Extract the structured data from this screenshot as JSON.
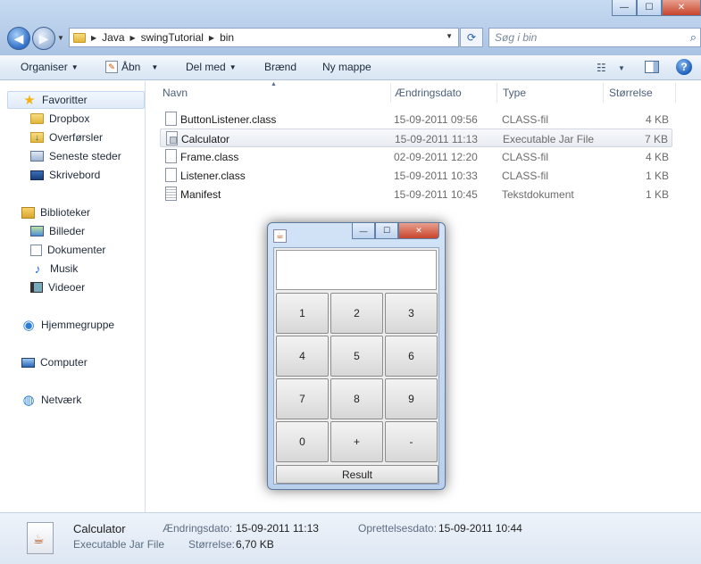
{
  "explorer": {
    "window_controls": {
      "minimize": "—",
      "maximize": "☐",
      "close": "✕"
    },
    "address": {
      "crumbs": [
        "Java",
        "swingTutorial",
        "bin"
      ]
    },
    "search": {
      "placeholder": "Søg i bin"
    },
    "toolbar": {
      "organise": "Organiser",
      "open": "Åbn",
      "share": "Del med",
      "burn": "Brænd",
      "new_folder": "Ny mappe"
    },
    "sidebar": {
      "favorites": "Favoritter",
      "fav_items": [
        "Dropbox",
        "Overførsler",
        "Seneste steder",
        "Skrivebord"
      ],
      "libraries": "Biblioteker",
      "lib_items": [
        "Billeder",
        "Dokumenter",
        "Musik",
        "Videoer"
      ],
      "homegroup": "Hjemmegruppe",
      "computer": "Computer",
      "network": "Netværk"
    },
    "columns": {
      "name": "Navn",
      "date": "Ændringsdato",
      "type": "Type",
      "size": "Størrelse"
    },
    "files": [
      {
        "name": "ButtonListener.class",
        "date": "15-09-2011 09:56",
        "type": "CLASS-fil",
        "size": "4 KB"
      },
      {
        "name": "Calculator",
        "date": "15-09-2011 11:13",
        "type": "Executable Jar File",
        "size": "7 KB"
      },
      {
        "name": "Frame.class",
        "date": "02-09-2011 12:20",
        "type": "CLASS-fil",
        "size": "4 KB"
      },
      {
        "name": "Listener.class",
        "date": "15-09-2011 10:33",
        "type": "CLASS-fil",
        "size": "1 KB"
      },
      {
        "name": "Manifest",
        "date": "15-09-2011 10:45",
        "type": "Tekstdokument",
        "size": "1 KB"
      }
    ],
    "details": {
      "name": "Calculator",
      "type": "Executable Jar File",
      "modified_label": "Ændringsdato:",
      "modified_value": "15-09-2011 11:13",
      "size_label": "Størrelse:",
      "size_value": "6,70 KB",
      "created_label": "Oprettelsesdato:",
      "created_value": "15-09-2011 10:44"
    }
  },
  "calculator": {
    "display_value": "",
    "keys": [
      "1",
      "2",
      "3",
      "4",
      "5",
      "6",
      "7",
      "8",
      "9",
      "0",
      "+",
      "-"
    ],
    "result_label": "Result",
    "controls": {
      "minimize": "—",
      "maximize": "☐",
      "close": "✕"
    }
  },
  "icons": {
    "back": "back-arrow-icon",
    "forward": "forward-arrow-icon",
    "search": "search-icon",
    "favorites": "star-icon",
    "folder": "folder-icon",
    "computer": "computer-icon",
    "network": "network-icon"
  }
}
